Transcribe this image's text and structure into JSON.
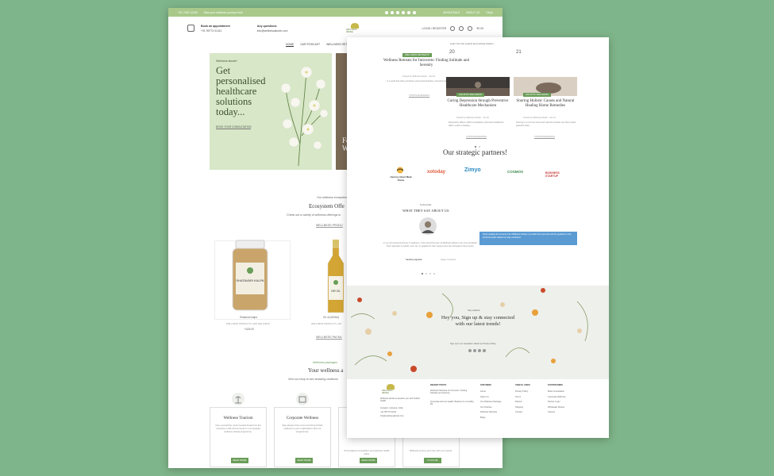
{
  "page1": {
    "topbar": {
      "left": "+91 7000 12345",
      "tagline": "Start your wellness journey Now!",
      "links": [
        "WHOLESALE",
        "ABOUT US",
        "FAQs"
      ]
    },
    "header": {
      "appointment_title": "Book an appointment",
      "appointment_phone": "+91 95773 01411",
      "questions_title": "Any questions",
      "questions_email": "info@wellnessabode.com",
      "login": "LOGIN / REGISTER",
      "cart": "₹0.00"
    },
    "nav": [
      "HOME",
      "OUR PODCAST",
      "WELLNESS RETREATS"
    ],
    "hero": {
      "tag": "Wellness abode!",
      "title": "Get personalised healthcare solutions today...",
      "cta": "BOOK YOUR CONSULTATION"
    },
    "hero2_text": "Fo W",
    "ecosystem": {
      "eyebrow": "Our wellness ecosystem",
      "title": "Ecosystem Offe",
      "subtitle": "Check out a variety of wellness offerings to",
      "products_label": "WELLNESS PRODU",
      "packages_label": "WELLNESS PACKA"
    },
    "products": [
      {
        "name": "Shatavari kalpa",
        "meta": "WELLNESS PRODUCTS, ADD WELLNESS",
        "price": "₹425.00",
        "label": "SHATAVARI KALPA"
      },
      {
        "name": "Gir oil (500ml)",
        "meta": "WELLNESS PRODUCTS, GIR",
        "price": "₹650.00",
        "label": "GIR OIL"
      }
    ],
    "wellness": {
      "eyebrow": "Wellness packages",
      "title": "Your wellness a",
      "subtitle": "Visit our shop to see amazing creations"
    },
    "cards": [
      {
        "title": "Wellness Tourism",
        "desc": "Give yourself the much needed break from the monotony of life and immerse in our bespoke wellness retreat programme.",
        "button": "READ MORE"
      },
      {
        "title": "Corporate Wellness",
        "desc": "Stay ahead of the curve and bring holistic wellness to your organisation with our programmes.",
        "button": "READ MORE"
      },
      {
        "title": "",
        "desc": "Personalised consultation and wellness health plans.",
        "button": "READ MORE"
      },
      {
        "title": "",
        "desc": "Wellness journey and care with our experts.",
        "button": "CLICK ME"
      }
    ]
  },
  "page2": {
    "top_text": "Learn from the experts and embody wisdom...",
    "posts": [
      {
        "tag": "WELLNESS RETREATS",
        "title": "Wellness Retreats for Introverts: Finding Solitude and Serenity",
        "meta": "Posted by Wellness Abode · Jan 20",
        "excerpt": "In a world that often prioritizes extroverted activities, introverts can find solace...",
        "more": "CONTINUE READING",
        "date": "20"
      },
      {
        "tag": "HOLISTIC WELLNESS",
        "title": "Curing Depression through Preventive Healthcare Mechanism",
        "meta": "Posted by Wellness Abode · Jan 20",
        "excerpt": "Depression affects millions worldwide; preventive healthcare offers a path to healing...",
        "more": "CONTINUE READING",
        "date": ""
      },
      {
        "tag": "HOLISTIC WELLNESS",
        "title": "Snoring Holistic Causes and Natural Healing Home Remedies",
        "meta": "Posted by Wellness Abode · Jan 21",
        "excerpt": "Snoring is a common issue and natural remedies can help restore peaceful sleep...",
        "more": "CONTINUE READING",
        "date": "21"
      }
    ],
    "partners_title": "Our strategic partners!",
    "partners": [
      "Journey About Mask Points",
      "xotoday",
      "Zimyo",
      "COSMOS",
      "BUSINESS STARTUP"
    ],
    "testimonials": {
      "eyebrow": "Testimonials",
      "title": "WHAT THEY SAY ABOUT US",
      "text": "In my own personal journey to wellness, I have found the team at Wellness Abode to be truly wonderful. Their approach is holistic, and I am so grateful for their support and care throughout the process.",
      "author": "Sandeep Agrawal",
      "author_role": "Happy Customer",
      "quote": "Since availing the services from Wellness Abode my health has improved and the guidance in the structured plan helped me stay consistent."
    },
    "newsletter": {
      "eyebrow": "Stay updated",
      "title": "Hey you, Sign up & stay connected with our latest trends!",
      "privacy_text": "Sign up to our newsletter. Read our Privacy Policy."
    },
    "footer": {
      "about": "Wellness abode empowers you with holistic health.",
      "address": "Gurgaon, Haryana, India",
      "phone": "+91 95773 01411",
      "email": "info@wellnessabode.com",
      "recent_title": "RECENT POSTS",
      "recent_posts": [
        "Wellness Retreats for Introverts: Finding Solitude and Serenity",
        "Ayurveda and Gut Health: Balance for a healthy life"
      ],
      "col1_title": "SITE MENU",
      "col1": [
        "Home",
        "About Us",
        "Our Wellness Package",
        "Our Podcast",
        "Wellness Retreats",
        "Blogs"
      ],
      "col2_title": "USEFUL LINKS",
      "col2": [
        "Privacy Policy",
        "Terms",
        "Refund",
        "Shipping",
        "Contact"
      ],
      "col3_title": "FOOTER MENU",
      "col3": [
        "Book Consultation",
        "Corporate Wellness",
        "Partner Login",
        "Wholesale Partner",
        "Careers"
      ]
    }
  },
  "colors": {
    "background": "#7fb58a",
    "accent": "#6a9d58",
    "hero": "#d7e7c7",
    "topbar": "#a8c98a",
    "quote": "#5a9bd4"
  }
}
